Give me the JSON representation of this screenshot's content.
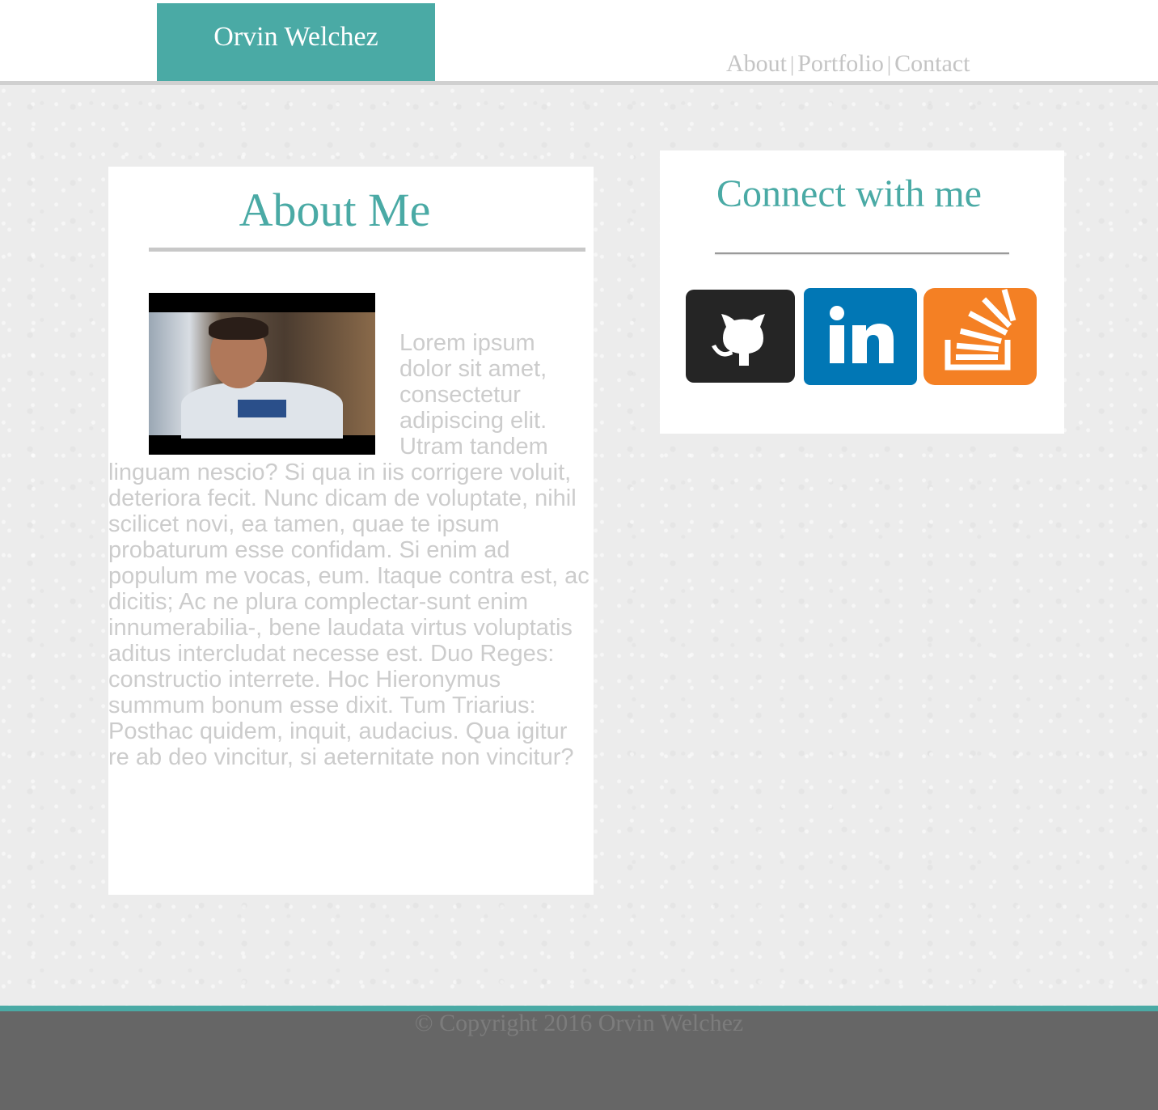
{
  "header": {
    "brand": "Orvin Welchez",
    "nav": [
      {
        "label": "About"
      },
      {
        "label": "Portfolio"
      },
      {
        "label": "Contact"
      }
    ],
    "separator": "|"
  },
  "about": {
    "title": "About Me",
    "photo_alt": "profile photo",
    "body": "Lorem ipsum dolor sit amet, consectetur adipiscing elit. Utram tandem linguam nescio? Si qua in iis corrigere voluit, deteriora fecit. Nunc dicam de voluptate, nihil scilicet novi, ea tamen, quae te ipsum probaturum esse confidam. Si enim ad populum me vocas, eum. Itaque contra est, ac dicitis; Ac ne plura complectar-sunt enim innumerabilia-, bene laudata virtus voluptatis aditus intercludat necesse est. Duo Reges: constructio interrete. Hoc Hieronymus summum bonum esse dixit. Tum Triarius: Posthac quidem, inquit, audacius. Qua igitur re ab deo vincitur, si aeternitate non vincitur?"
  },
  "connect": {
    "title": "Connect with me",
    "links": [
      {
        "icon": "github-icon",
        "color": "#252525"
      },
      {
        "icon": "linkedin-icon",
        "color": "#0177b5"
      },
      {
        "icon": "stackoverflow-icon",
        "color": "#f48024"
      }
    ]
  },
  "footer": {
    "copyright": "© Copyright 2016 Orvin Welchez"
  },
  "colors": {
    "accent": "#4aaaa5",
    "footer_bg": "#666666",
    "muted_text": "#cccccc"
  }
}
